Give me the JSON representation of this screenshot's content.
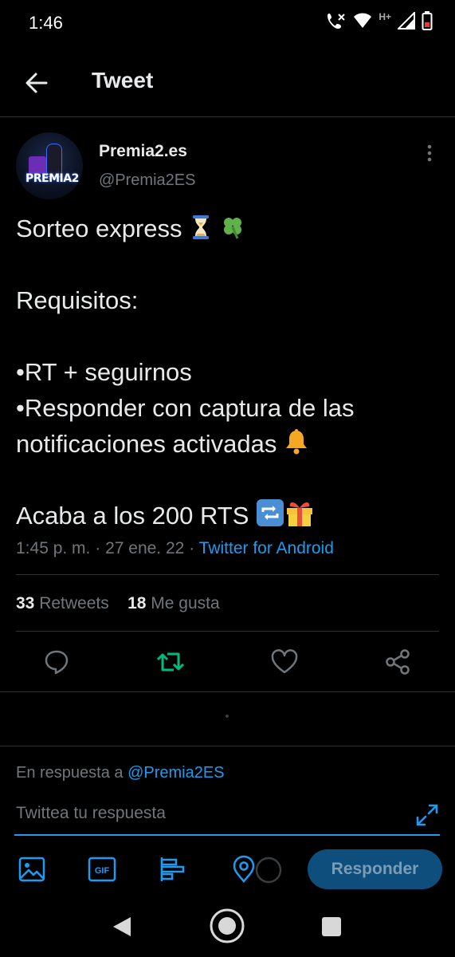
{
  "status_bar": {
    "time": "1:46",
    "network": "H+"
  },
  "header": {
    "title": "Tweet"
  },
  "author": {
    "display_name": "Premia2.es",
    "handle": "@Premia2ES",
    "avatar_text": "PREMIA2"
  },
  "tweet": {
    "lines": [
      "Sorteo express",
      "Requisitos:",
      "•RT + seguirnos",
      "•Responder con captura de las notificaciones activadas",
      "Acaba a los 200 RTS"
    ],
    "time": "1:45 p. m.",
    "date": "27 ene. 22",
    "sep": "·",
    "source": "Twitter for Android"
  },
  "stats": {
    "retweets_count": "33",
    "retweets_label": "Retweets",
    "likes_count": "18",
    "likes_label": "Me gusta"
  },
  "reply": {
    "prefix": "En respuesta a",
    "mention": "@Premia2ES",
    "placeholder": "Twittea tu respuesta",
    "button_label": "Responder",
    "gif_label": "GIF"
  },
  "colors": {
    "accent": "#1d9bf0",
    "retweet_green": "#00ba7c",
    "muted": "#71767b",
    "background": "#000000"
  },
  "icons": {
    "back": "arrow-left-icon",
    "more": "more-vertical-icon",
    "reply": "comment-icon",
    "retweet": "retweet-icon",
    "like": "heart-icon",
    "share": "share-icon",
    "expand": "expand-icon",
    "image": "image-icon",
    "gif": "gif-icon",
    "poll": "poll-icon",
    "location": "location-icon"
  }
}
